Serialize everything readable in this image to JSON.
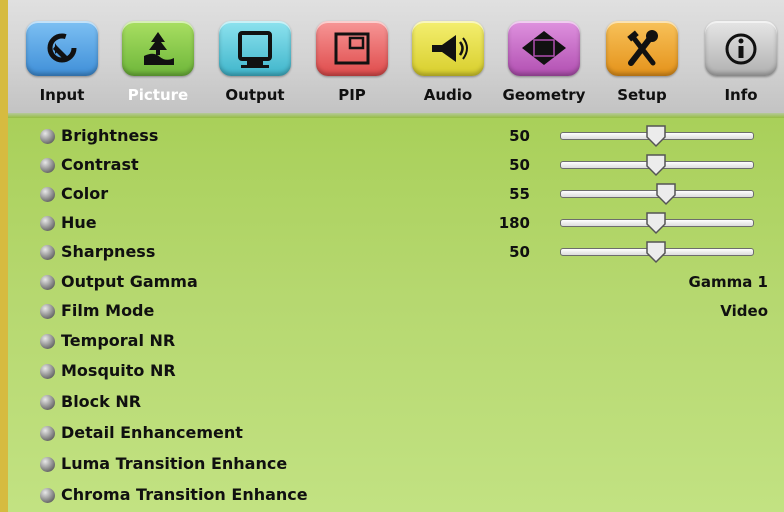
{
  "tabs": [
    {
      "label": "Input",
      "icon": "input-icon",
      "color": "#5aa6e6",
      "active": false
    },
    {
      "label": "Picture",
      "icon": "picture-icon",
      "color": "#8fcf44",
      "active": true
    },
    {
      "label": "Output",
      "icon": "monitor-icon",
      "color": "#58c6d6",
      "active": false
    },
    {
      "label": "PIP",
      "icon": "pip-icon",
      "color": "#f06a6a",
      "active": false
    },
    {
      "label": "Audio",
      "icon": "speaker-icon",
      "color": "#e8e044",
      "active": false
    },
    {
      "label": "Geometry",
      "icon": "diamond-icon",
      "color": "#c66cc6",
      "active": false
    },
    {
      "label": "Setup",
      "icon": "tools-icon",
      "color": "#f2a928",
      "active": false
    },
    {
      "label": "Info",
      "icon": "info-icon",
      "color": "#c6c6c6",
      "active": false
    }
  ],
  "picture_menu": {
    "items": [
      {
        "label": "Brightness",
        "value": "50",
        "slider": 0.5
      },
      {
        "label": "Contrast",
        "value": "50",
        "slider": 0.5
      },
      {
        "label": "Color",
        "value": "55",
        "slider": 0.55
      },
      {
        "label": "Hue",
        "value": "180",
        "slider": 0.5
      },
      {
        "label": "Sharpness",
        "value": "50",
        "slider": 0.5
      },
      {
        "label": "Output Gamma",
        "setting": "Gamma 1"
      },
      {
        "label": "Film Mode",
        "setting": "Video"
      },
      {
        "label": "Temporal NR"
      },
      {
        "label": "Mosquito NR"
      },
      {
        "label": "Block NR"
      },
      {
        "label": "Detail Enhancement"
      },
      {
        "label": "Luma Transition Enhance"
      },
      {
        "label": "Chroma Transition Enhance"
      }
    ]
  },
  "colors": {
    "menu_background": "#a9d05a",
    "left_border": "#d6bb40",
    "active_tab_text": "#ffffff"
  }
}
